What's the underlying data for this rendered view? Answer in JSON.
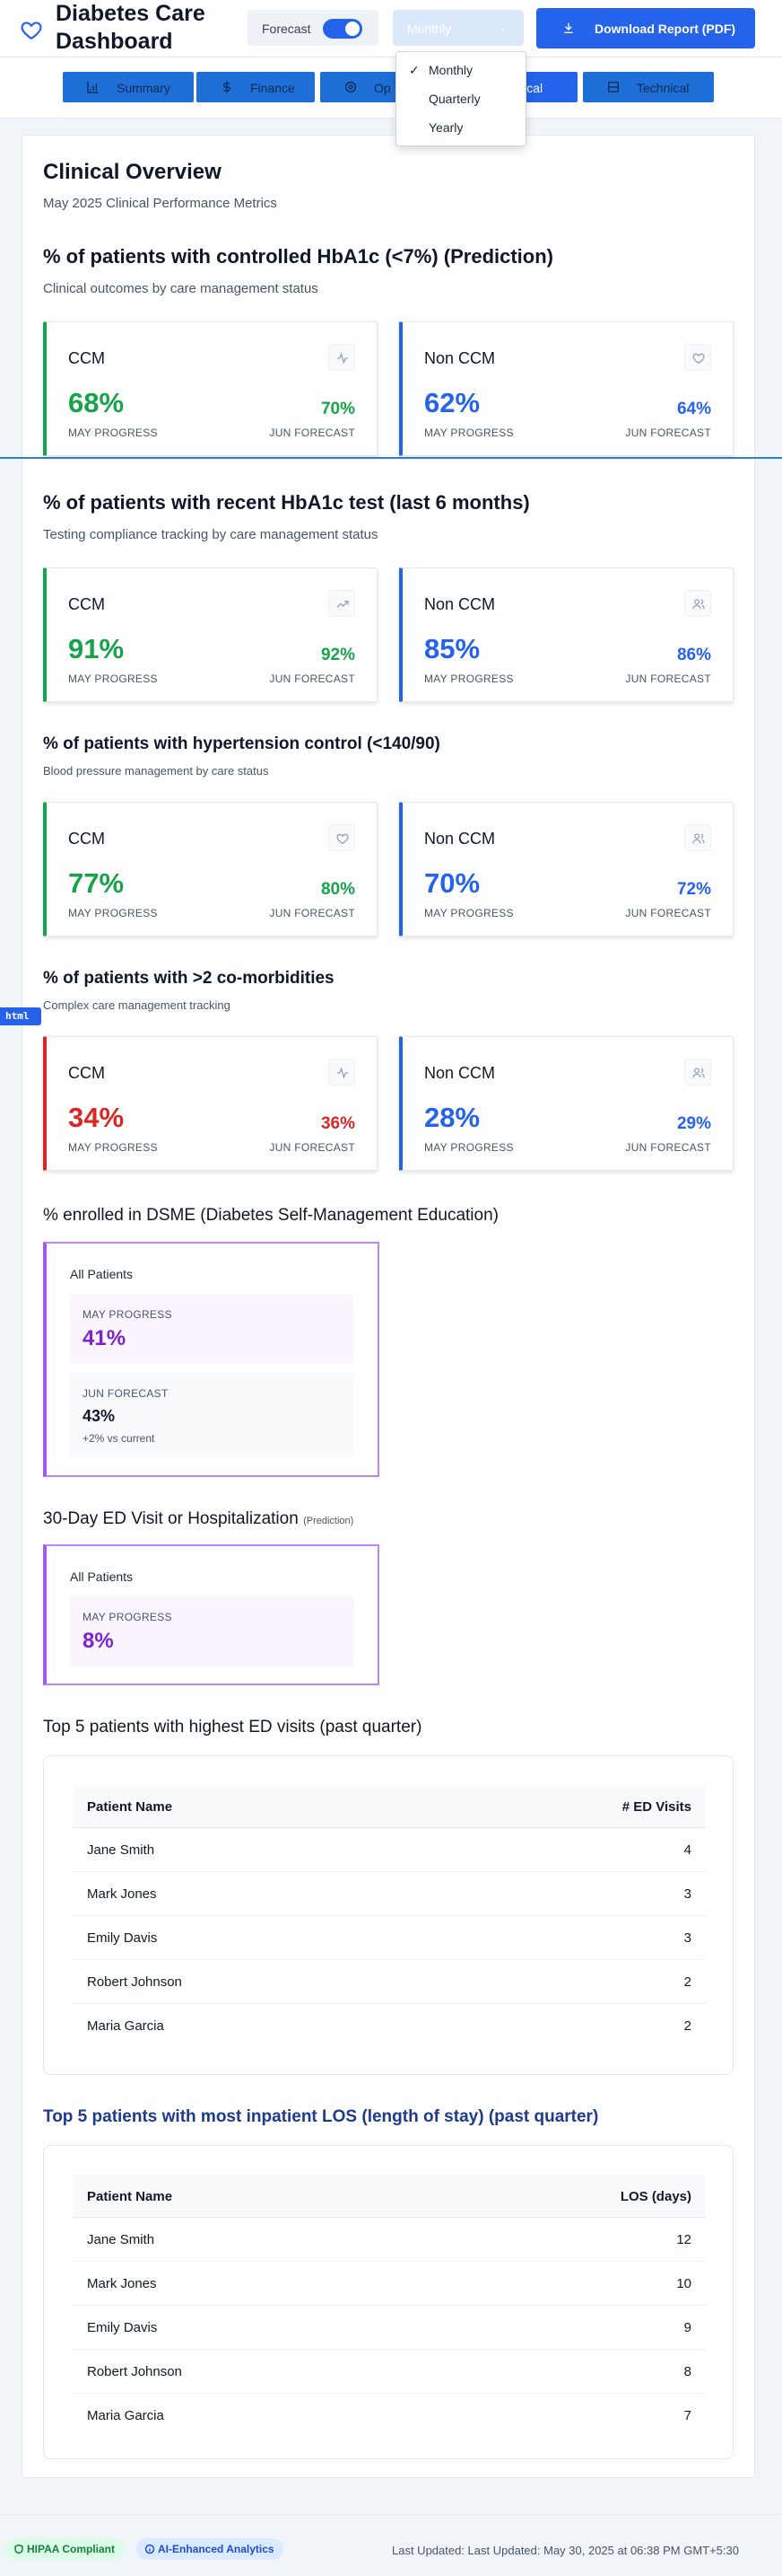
{
  "header": {
    "title": "Diabetes Care Dashboard",
    "forecast_label": "Forecast",
    "period_value": "Monthly",
    "download_label": "Download Report (PDF)"
  },
  "tabs": [
    {
      "label": "Summary",
      "icon": "chart-icon"
    },
    {
      "label": "Finance",
      "icon": "dollar-icon"
    },
    {
      "label": "Op",
      "icon": "gear-icon"
    },
    {
      "label": "Clinical",
      "icon": "clinical-icon"
    },
    {
      "label": "Technical",
      "icon": "database-icon"
    }
  ],
  "period_options": [
    "Monthly",
    "Quarterly",
    "Yearly"
  ],
  "overview": {
    "title": "Clinical Overview",
    "subtitle": "May 2025 Clinical Performance Metrics"
  },
  "sections": [
    {
      "title": "% of patients with controlled HbA1c (<7%) (Prediction)",
      "subtitle": "Clinical outcomes by care management status",
      "ccm": {
        "label": "CCM",
        "may": "68%",
        "jun": "70%",
        "icon": "activity-icon"
      },
      "nonccm": {
        "label": "Non CCM",
        "may": "62%",
        "jun": "64%",
        "icon": "heart-icon"
      }
    },
    {
      "title": "% of patients with recent HbA1c test (last 6 months)",
      "subtitle": "Testing compliance tracking by care management status",
      "ccm": {
        "label": "CCM",
        "may": "91%",
        "jun": "92%",
        "icon": "trending-up-icon"
      },
      "nonccm": {
        "label": "Non CCM",
        "may": "85%",
        "jun": "86%",
        "icon": "users-icon"
      }
    },
    {
      "title": "% of patients with hypertension control (<140/90)",
      "subtitle": "Blood pressure management by care status",
      "ccm": {
        "label": "CCM",
        "may": "77%",
        "jun": "80%",
        "icon": "heart-icon"
      },
      "nonccm": {
        "label": "Non CCM",
        "may": "70%",
        "jun": "72%",
        "icon": "users-icon"
      }
    },
    {
      "title": "% of patients with >2 co-morbidities",
      "subtitle": "Complex care management tracking",
      "ccm": {
        "label": "CCM",
        "may": "34%",
        "jun": "36%",
        "icon": "activity-icon"
      },
      "nonccm": {
        "label": "Non CCM",
        "may": "28%",
        "jun": "29%",
        "icon": "users-icon"
      }
    }
  ],
  "captions": {
    "may": "MAY PROGRESS",
    "jun": "JUN FORECAST"
  },
  "dsme": {
    "title": "% enrolled in DSME (Diabetes Self-Management Education)",
    "group": "All Patients",
    "may_caption": "MAY PROGRESS",
    "may_value": "41%",
    "jun_caption": "JUN FORECAST",
    "jun_value": "43%",
    "jun_note": "+2% vs current"
  },
  "ed30": {
    "title": "30-Day ED Visit or Hospitalization",
    "tag": "(Prediction)",
    "group": "All Patients",
    "may_caption": "MAY PROGRESS",
    "may_value": "8%"
  },
  "ed_table": {
    "title": "Top 5 patients with highest ED visits (past quarter)",
    "col_name": "Patient Name",
    "col_value": "# ED Visits",
    "rows": [
      {
        "name": "Jane Smith",
        "value": "4"
      },
      {
        "name": "Mark Jones",
        "value": "3"
      },
      {
        "name": "Emily Davis",
        "value": "3"
      },
      {
        "name": "Robert Johnson",
        "value": "2"
      },
      {
        "name": "Maria Garcia",
        "value": "2"
      }
    ]
  },
  "los_table": {
    "title": "Top 5 patients with most inpatient LOS (length of stay) (past quarter)",
    "col_name": "Patient Name",
    "col_value": "LOS (days)",
    "rows": [
      {
        "name": "Jane Smith",
        "value": "12"
      },
      {
        "name": "Mark Jones",
        "value": "10"
      },
      {
        "name": "Emily Davis",
        "value": "9"
      },
      {
        "name": "Robert Johnson",
        "value": "8"
      },
      {
        "name": "Maria Garcia",
        "value": "7"
      }
    ]
  },
  "footer": {
    "hipaa": "HIPAA Compliant",
    "ai": "AI-Enhanced Analytics",
    "updated": "Last Updated: Last Updated: May 30, 2025 at 06:38 PM GMT+5:30"
  },
  "overlay_tag": "html",
  "colors": {
    "primary": "#2563eb",
    "ccm_good": "#16a34a",
    "ccm_alert": "#dc2626",
    "purple": "#a855f7"
  }
}
